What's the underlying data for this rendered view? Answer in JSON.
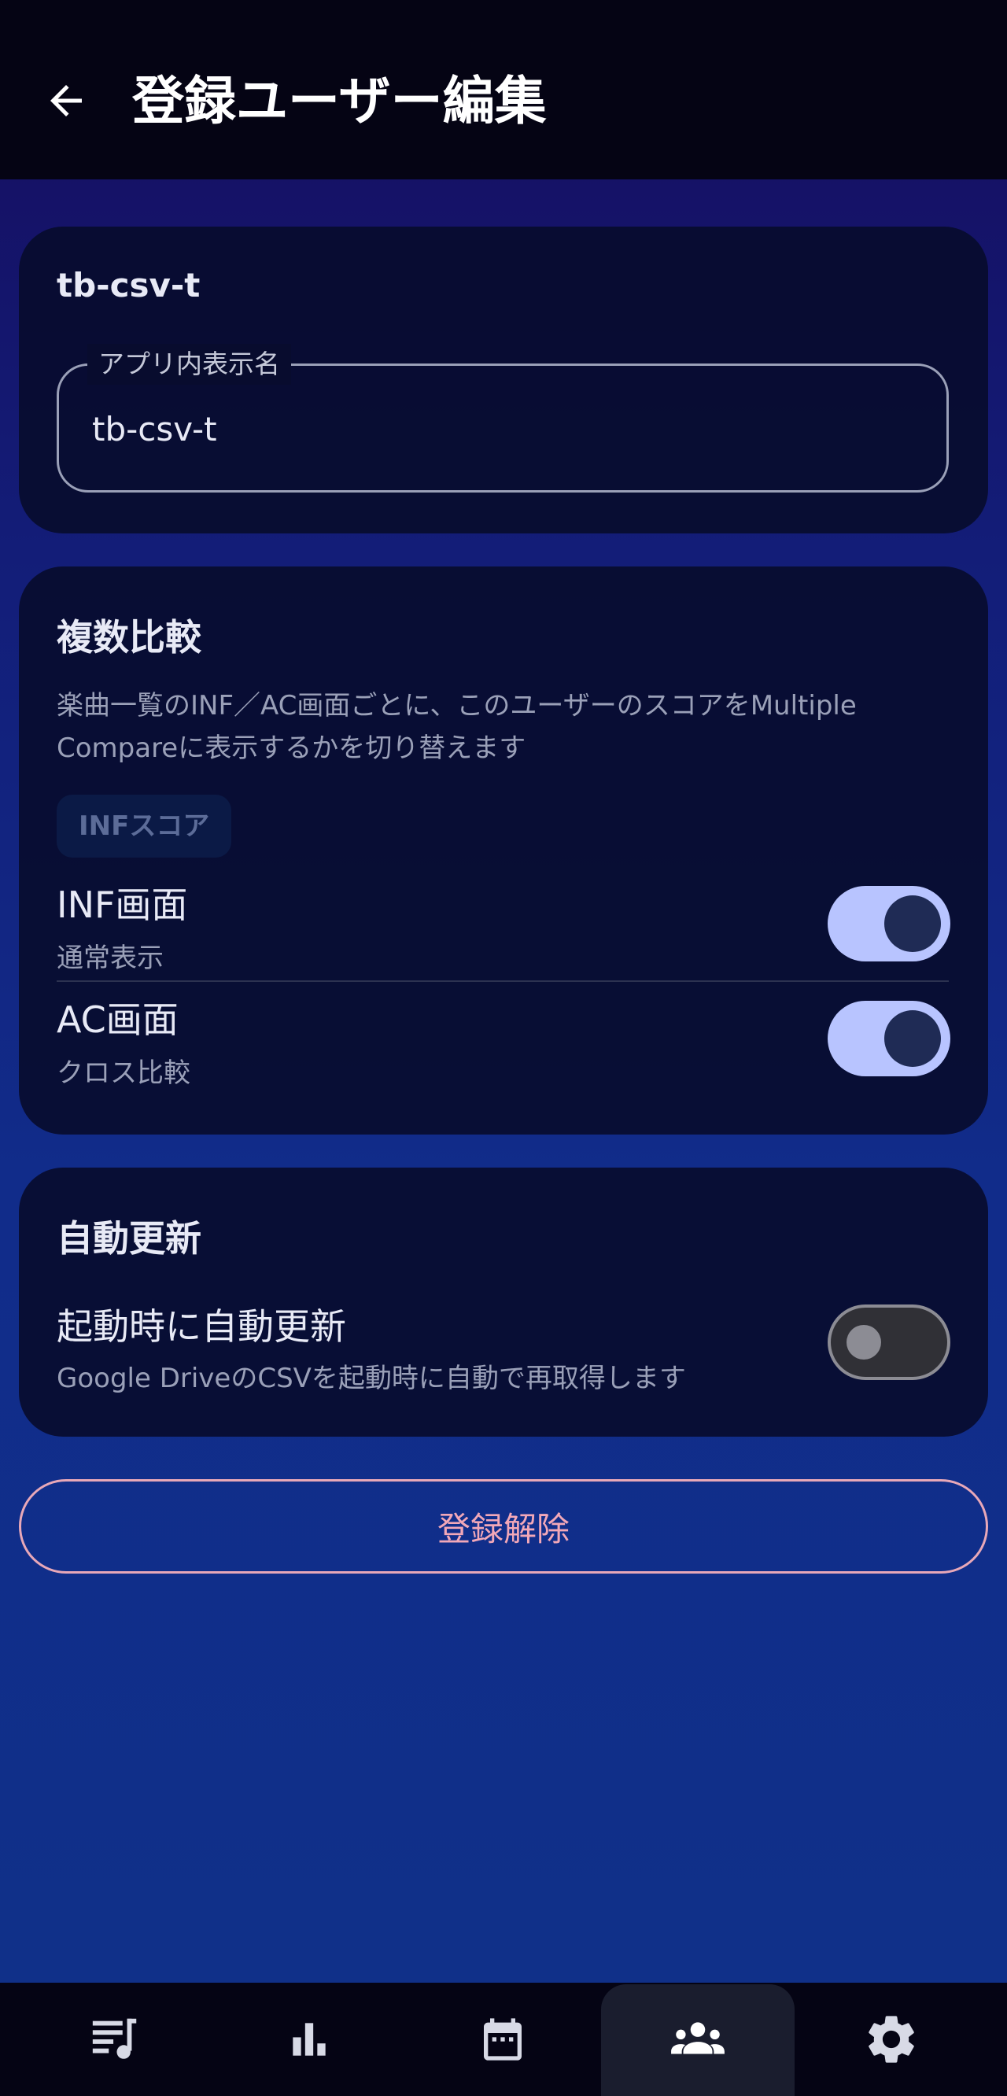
{
  "app_bar": {
    "title": "登録ユーザー編集",
    "back_icon": "arrow-left-icon"
  },
  "user_card": {
    "user_id": "tb-csv-t",
    "display_name_label": "アプリ内表示名",
    "display_name_value": "tb-csv-t"
  },
  "multi_compare": {
    "title": "複数比較",
    "description": "楽曲一覧のINF／AC画面ごとに、このユーザーのスコアをMultiple Compareに表示するかを切り替えます",
    "chip_label": "INFスコア",
    "rows": [
      {
        "title": "INF画面",
        "subtitle": "通常表示",
        "enabled": true
      },
      {
        "title": "AC画面",
        "subtitle": "クロス比較",
        "enabled": true
      }
    ]
  },
  "auto_update": {
    "title": "自動更新",
    "row": {
      "title": "起動時に自動更新",
      "subtitle": "Google DriveのCSVを起動時に自動で再取得します",
      "enabled": false
    }
  },
  "unregister_button": {
    "label": "登録解除",
    "color": "#f2a8b8"
  },
  "bottom_nav": {
    "items": [
      {
        "name": "song-list-icon",
        "active": false
      },
      {
        "name": "bar-chart-icon",
        "active": false
      },
      {
        "name": "calendar-icon",
        "active": false
      },
      {
        "name": "users-icon",
        "active": true
      },
      {
        "name": "gear-icon",
        "active": false
      }
    ]
  },
  "colors": {
    "switch_on_track": "#b8c4ff",
    "switch_on_knob": "#1f2b55",
    "switch_off_track": "#303036",
    "bar_background": "#050414"
  }
}
